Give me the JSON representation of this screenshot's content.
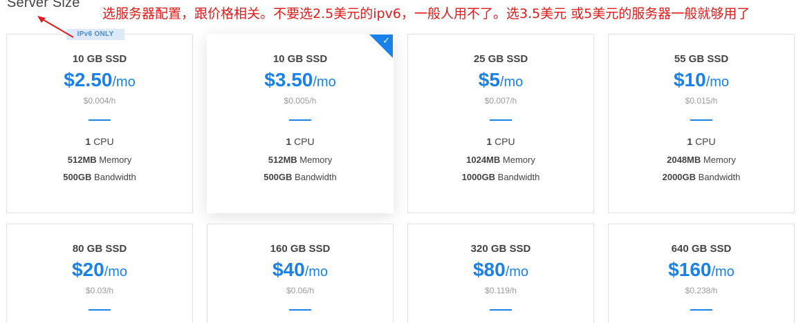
{
  "section_title": "Server Size",
  "annotation": "选服务器配置，跟价格相关。不要选2.5美元的ipv6，一般人用不了。选3.5美元 或5美元的服务器一般就够用了",
  "accent_color": "#1a81e8",
  "annotation_color": "#e21a1a",
  "ipv6_badge": "IPv6 ONLY",
  "check_icon": "✓",
  "plans": [
    {
      "storage": "10 GB SSD",
      "price": "$2.50",
      "per": "/mo",
      "hourly": "$0.004/h",
      "cpu_count": "1",
      "cpu_label": "CPU",
      "memory": "512MB",
      "memory_label": "Memory",
      "bandwidth": "500GB",
      "bandwidth_label": "Bandwidth",
      "selected": false,
      "badge": "IPv6 ONLY"
    },
    {
      "storage": "10 GB SSD",
      "price": "$3.50",
      "per": "/mo",
      "hourly": "$0.005/h",
      "cpu_count": "1",
      "cpu_label": "CPU",
      "memory": "512MB",
      "memory_label": "Memory",
      "bandwidth": "500GB",
      "bandwidth_label": "Bandwidth",
      "selected": true
    },
    {
      "storage": "25 GB SSD",
      "price": "$5",
      "per": "/mo",
      "hourly": "$0.007/h",
      "cpu_count": "1",
      "cpu_label": "CPU",
      "memory": "1024MB",
      "memory_label": "Memory",
      "bandwidth": "1000GB",
      "bandwidth_label": "Bandwidth",
      "selected": false
    },
    {
      "storage": "55 GB SSD",
      "price": "$10",
      "per": "/mo",
      "hourly": "$0.015/h",
      "cpu_count": "1",
      "cpu_label": "CPU",
      "memory": "2048MB",
      "memory_label": "Memory",
      "bandwidth": "2000GB",
      "bandwidth_label": "Bandwidth",
      "selected": false
    },
    {
      "storage": "80 GB SSD",
      "price": "$20",
      "per": "/mo",
      "hourly": "$0.03/h",
      "selected": false
    },
    {
      "storage": "160 GB SSD",
      "price": "$40",
      "per": "/mo",
      "hourly": "$0.06/h",
      "selected": false
    },
    {
      "storage": "320 GB SSD",
      "price": "$80",
      "per": "/mo",
      "hourly": "$0.119/h",
      "selected": false
    },
    {
      "storage": "640 GB SSD",
      "price": "$160",
      "per": "/mo",
      "hourly": "$0.238/h",
      "selected": false
    }
  ]
}
